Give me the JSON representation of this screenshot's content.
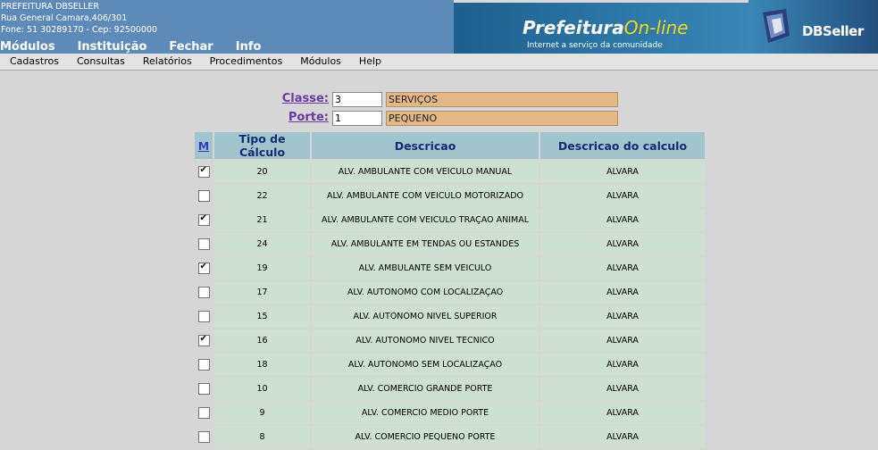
{
  "header": {
    "org": "PREFEITURA DBSELLER",
    "address": "Rua General Camara,406/301",
    "phone": "Fone: 51 30289170  -  Cep: 92500000",
    "main_menu": [
      "Módulos",
      "Instituição",
      "Fechar",
      "Info"
    ]
  },
  "banner": {
    "brand_a": "Prefeitura",
    "brand_b": "On-line",
    "tagline": "Internet a serviço da comunidade",
    "company": "DBSeller"
  },
  "menubar": [
    "Cadastros",
    "Consultas",
    "Relatórios",
    "Procedimentos",
    "Módulos",
    "Help"
  ],
  "form": {
    "classe": {
      "label": "Classe:",
      "value": "3",
      "desc": "SERVIÇOS"
    },
    "porte": {
      "label": "Porte:",
      "value": "1",
      "desc": "PEQUENO"
    }
  },
  "table": {
    "headers": [
      "M",
      "Tipo de Cálculo",
      "Descricao",
      "Descricao do calculo"
    ],
    "rows": [
      {
        "checked": true,
        "tipo": "20",
        "descricao": "ALV. AMBULANTE COM VEICULO MANUAL",
        "calc": "ALVARA"
      },
      {
        "checked": false,
        "tipo": "22",
        "descricao": "ALV. AMBULANTE COM VEICULO MOTORIZADO",
        "calc": "ALVARA"
      },
      {
        "checked": true,
        "tipo": "21",
        "descricao": "ALV. AMBULANTE COM VEICULO TRAÇAO ANIMAL",
        "calc": "ALVARA"
      },
      {
        "checked": false,
        "tipo": "24",
        "descricao": "ALV. AMBULANTE EM TENDAS OU ESTANDES",
        "calc": "ALVARA"
      },
      {
        "checked": true,
        "tipo": "19",
        "descricao": "ALV. AMBULANTE SEM VEICULO",
        "calc": "ALVARA"
      },
      {
        "checked": false,
        "tipo": "17",
        "descricao": "ALV. AUTONOMO COM LOCALIZAÇAO",
        "calc": "ALVARA"
      },
      {
        "checked": false,
        "tipo": "15",
        "descricao": "ALV. AUTONOMO NIVEL SUPERIOR",
        "calc": "ALVARA"
      },
      {
        "checked": true,
        "tipo": "16",
        "descricao": "ALV. AUTONOMO NIVEL TECNICO",
        "calc": "ALVARA"
      },
      {
        "checked": false,
        "tipo": "18",
        "descricao": "ALV. AUTONOMO SEM LOCALIZAÇAO",
        "calc": "ALVARA"
      },
      {
        "checked": false,
        "tipo": "10",
        "descricao": "ALV. COMERCIO GRANDE PORTE",
        "calc": "ALVARA"
      },
      {
        "checked": false,
        "tipo": "9",
        "descricao": "ALV. COMERCIO MEDIO PORTE",
        "calc": "ALVARA"
      },
      {
        "checked": false,
        "tipo": "8",
        "descricao": "ALV. COMERCIO PEQUENO PORTE",
        "calc": "ALVARA"
      }
    ]
  },
  "colors": {
    "header_bg": "#5c8bb9",
    "row_bg": "#cde0d1",
    "header_cell_bg": "#a2c5cd",
    "desc_field_bg": "#e2b885"
  }
}
